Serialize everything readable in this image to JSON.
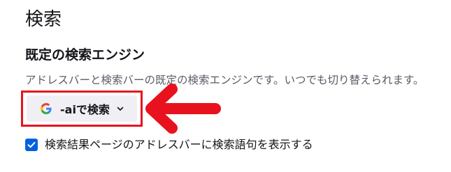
{
  "section": {
    "title": "検索"
  },
  "default_engine": {
    "heading": "既定の検索エンジン",
    "description": "アドレスバーと検索バーの既定の検索エンジンです。いつでも切り替えられます。",
    "selected_engine": "-aiで検索",
    "engine_icon": "google-g-icon",
    "dropdown_icon": "chevron-down-icon"
  },
  "annotation": {
    "highlight_color": "#e8121f",
    "arrow_color": "#e8121f"
  },
  "options": {
    "show_in_address_bar": {
      "label": "検索結果ページのアドレスバーに検索語句を表示する",
      "checked": true,
      "color": "#0061e0"
    }
  }
}
